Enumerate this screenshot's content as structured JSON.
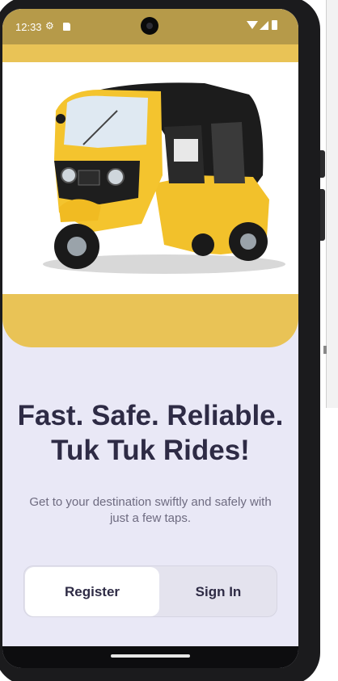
{
  "status_bar": {
    "time": "12:33",
    "settings_icon": "gear-icon",
    "sd_icon": "sd-card-icon",
    "wifi_icon": "wifi-icon",
    "signal_icon": "cell-signal-icon",
    "battery_icon": "battery-icon"
  },
  "hero": {
    "image_subject": "yellow auto rickshaw (tuk tuk)"
  },
  "content": {
    "headline": "Fast. Safe. Reliable. Tuk Tuk Rides!",
    "subtitle": "Get to your destination swiftly and safely with just a few taps."
  },
  "auth_toggle": {
    "register_label": "Register",
    "signin_label": "Sign In",
    "selected": "Register"
  },
  "colors": {
    "status_bar": "#b69a49",
    "hero_accent": "#e9c356",
    "background": "#e9e8f6",
    "text_primary": "#2e2b45",
    "text_secondary": "#6e6b80"
  }
}
